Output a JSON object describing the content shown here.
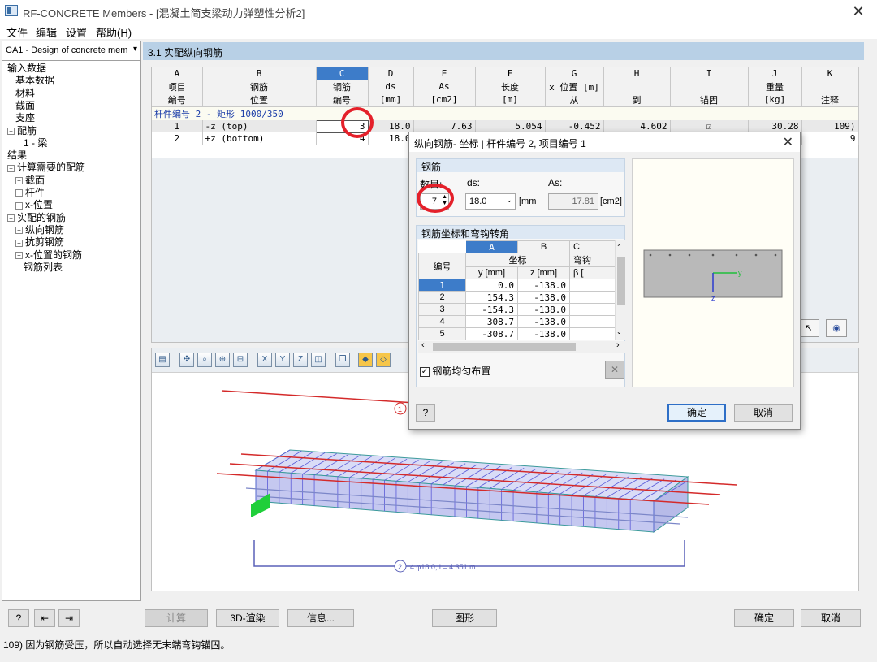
{
  "window": {
    "title": "RF-CONCRETE Members - [混凝土简支梁动力弹塑性分析2]",
    "close_glyph": "✕"
  },
  "menu": [
    "文件",
    "编辑",
    "设置",
    "帮助(H)"
  ],
  "left": {
    "case_select": "CA1 - Design of concrete mem",
    "tree": [
      {
        "label": "输入数据",
        "level": 0,
        "pm": ""
      },
      {
        "label": "基本数据",
        "level": 1,
        "pm": ""
      },
      {
        "label": "材料",
        "level": 1,
        "pm": ""
      },
      {
        "label": "截面",
        "level": 1,
        "pm": ""
      },
      {
        "label": "支座",
        "level": 1,
        "pm": ""
      },
      {
        "label": "配筋",
        "level": 0,
        "pm": "-"
      },
      {
        "label": "1 - 梁",
        "level": 2,
        "pm": ""
      },
      {
        "label": "结果",
        "level": 0,
        "pm": ""
      },
      {
        "label": "计算需要的配筋",
        "level": 0,
        "pm": "-"
      },
      {
        "label": "截面",
        "level": 1,
        "pm": "+"
      },
      {
        "label": "杆件",
        "level": 1,
        "pm": "+"
      },
      {
        "label": "x-位置",
        "level": 1,
        "pm": "+"
      },
      {
        "label": "实配的钢筋",
        "level": 0,
        "pm": "-"
      },
      {
        "label": "纵向钢筋",
        "level": 1,
        "pm": "+"
      },
      {
        "label": "抗剪钢筋",
        "level": 1,
        "pm": "+"
      },
      {
        "label": "x-位置的钢筋",
        "level": 1,
        "pm": "+"
      },
      {
        "label": "钢筋列表",
        "level": 2,
        "pm": ""
      }
    ]
  },
  "section_title": "3.1 实配纵向钢筋",
  "table": {
    "col_letters": [
      "A",
      "B",
      "C",
      "D",
      "E",
      "F",
      "G",
      "H",
      "I",
      "J",
      "K"
    ],
    "h1": [
      "项目",
      "钢筋",
      "钢筋",
      "ds",
      "As",
      "长度",
      "x 位置 [m]",
      "",
      "",
      "重量",
      ""
    ],
    "h2": [
      "编号",
      "位置",
      "编号",
      "[mm]",
      "[cm2]",
      "[m]",
      "从",
      "到",
      "锚固",
      "[kg]",
      "注释"
    ],
    "member_row": "杆件编号 2  -  矩形 1000/350",
    "rows": [
      [
        "1",
        "-z (top)",
        "3",
        "18.0",
        "7.63",
        "5.054",
        "-0.452",
        "4.602",
        "☑",
        "30.28",
        "109)"
      ],
      [
        "2",
        "+z (bottom)",
        "4",
        "18.0",
        "",
        "",
        "",
        "",
        "",
        "",
        "9"
      ]
    ],
    "row1_button": "."
  },
  "dialog": {
    "title": "纵向钢筋- 坐标 | 杆件编号 2, 项目编号 1",
    "group1": "钢筋",
    "count_label": "数目:",
    "count_value": "7",
    "ds_label": "ds:",
    "ds_value": "18.0",
    "ds_unit": "[mm",
    "as_label": "As:",
    "as_value": "17.81",
    "as_unit": "[cm2]",
    "group2": "钢筋坐标和弯钩转角",
    "col_letters": [
      "A",
      "B",
      "C"
    ],
    "h1": [
      "坐标",
      "弯钩"
    ],
    "h2": [
      "编号",
      "y [mm]",
      "z [mm]",
      "β ["
    ],
    "rows": [
      [
        "1",
        "0.0",
        "-138.0"
      ],
      [
        "2",
        "154.3",
        "-138.0"
      ],
      [
        "3",
        "-154.3",
        "-138.0"
      ],
      [
        "4",
        "308.7",
        "-138.0"
      ],
      [
        "5",
        "-308.7",
        "-138.0"
      ]
    ],
    "even_label": "钢筋均匀布置",
    "ok": "确定",
    "cancel": "取消",
    "axis_y": "y",
    "axis_z": "z"
  },
  "view": {
    "label1": "1",
    "label2": "2",
    "dim_text": "4 φ18.0, l = 4.351 m"
  },
  "bottom": {
    "calc": "计算",
    "render": "3D-渲染",
    "info": "信息...",
    "graphic": "图形",
    "ok": "确定",
    "cancel": "取消"
  },
  "status": "109) 因为钢筋受压，所以自动选择无末端弯钩锚固。",
  "colors": {
    "accent": "#3d7cc9",
    "header": "#b8d0e6",
    "highlight_circle": "#e4202a"
  }
}
